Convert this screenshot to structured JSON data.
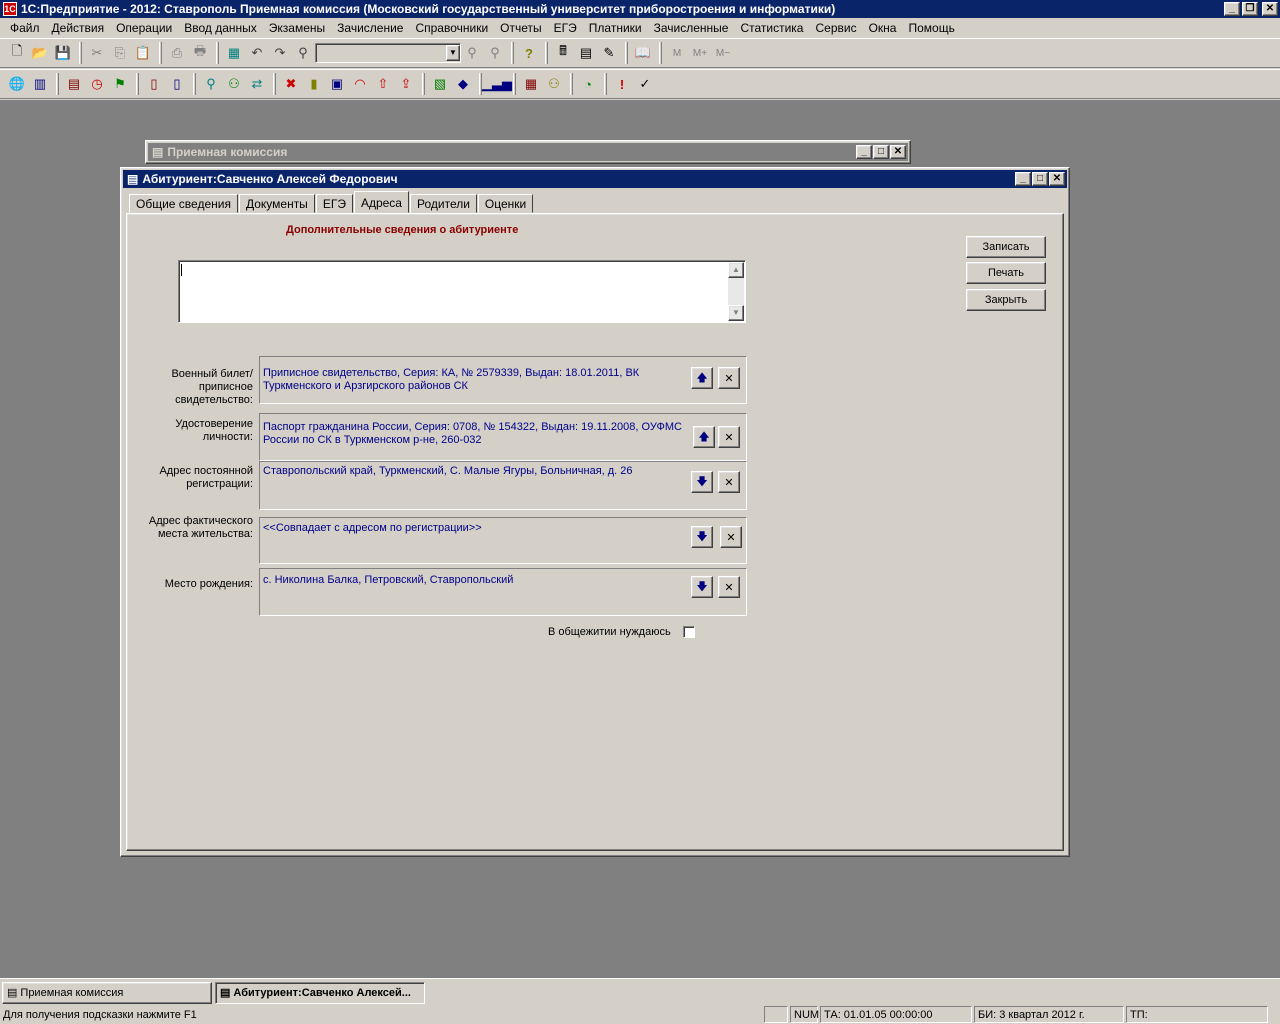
{
  "app": {
    "title": "1С:Предприятие - 2012: Ставрополь Приемная комиссия (Московский государственный университет приборостроения и информатики)"
  },
  "menu": [
    "Файл",
    "Действия",
    "Операции",
    "Ввод данных",
    "Экзамены",
    "Зачисление",
    "Справочники",
    "Отчеты",
    "ЕГЭ",
    "Платники",
    "Зачисленные",
    "Статистика",
    "Сервис",
    "Окна",
    "Помощь"
  ],
  "toolbar1": [
    "new-icon",
    "open-icon",
    "save-icon",
    "cut-icon",
    "copy-icon",
    "paste-icon",
    "print-icon",
    "print-preview-icon",
    "calendar-icon",
    "undo-icon",
    "redo-icon",
    "find-icon",
    "combo",
    "find-next-icon",
    "replace-icon",
    "help-icon",
    "calculator-icon",
    "spreadsheet-icon",
    "edit-icon",
    "book-icon",
    "M",
    "M+",
    "M-"
  ],
  "toolbar2": [
    "globe-icon",
    "people-icon",
    "journal-icon",
    "clock-icon",
    "graduation-icon",
    "book-open-icon",
    "notebook-icon",
    "search-people-icon",
    "group-icon",
    "transfer-icon",
    "delete-person-icon",
    "books-icon",
    "exam-icon",
    "rainbow-icon",
    "upload-icon",
    "upgrade-icon",
    "report-icon",
    "book-blue-icon",
    "chart-icon",
    "table-icon",
    "crowd-icon",
    "gauge-icon",
    "info-icon",
    "check-icon"
  ],
  "bg_window": {
    "title": "Приемная комиссия"
  },
  "dialog": {
    "title": "Абитуриент:Савченко Алексей Федорович",
    "tabs": [
      "Общие сведения",
      "Документы",
      "ЕГЭ",
      "Адреса",
      "Родители",
      "Оценки"
    ],
    "selected_tab": "Адреса",
    "heading": "Дополнительные сведения о абитуриенте",
    "notes_value": "",
    "fields": [
      {
        "label": "Военный билет/ приписное свидетельство:",
        "value": "Приписное свидетельство, Серия: КА, № 2579339, Выдан: 18.01.2011, ВК Туркменского и Арзгирского районов СК",
        "arrow": "up"
      },
      {
        "label": "Удостоверение личности:",
        "value": "Паспорт гражданина России, Серия: 0708, № 154322, Выдан: 19.11.2008, ОУФМС России по СК в Туркменском р-не, 260-032",
        "arrow": "up"
      },
      {
        "label": "Адрес постоянной регистрации:",
        "value": "Ставропольский край, Туркменский, С. Малые Ягуры, Больничная, д. 26",
        "arrow": "down"
      },
      {
        "label": "Адрес фактического места жительства:",
        "value": "<<Совпадает с адресом по регистрации>>",
        "arrow": "down"
      },
      {
        "label": "Место рождения:",
        "value": "с. Николина Балка, Петровский, Ставропольский",
        "arrow": "down"
      }
    ],
    "dormitory_label": "В общежитии нуждаюсь",
    "dormitory_checked": false,
    "buttons": {
      "save": "Записать",
      "print": "Печать",
      "close": "Закрыть"
    }
  },
  "taskbar": [
    "Приемная комиссия",
    "Абитуриент:Савченко Алексей..."
  ],
  "status": {
    "hint": "Для получения подсказки нажмите F1",
    "num": "NUM",
    "ta": "ТА: 01.01.05  00:00:00",
    "bi": "БИ: 3 квартал 2012 г.",
    "tp": "ТП:"
  },
  "colors": {
    "title_active": "#0a246a",
    "field_text": "#00008b",
    "heading": "#8b0000",
    "workspace": "#808080"
  }
}
